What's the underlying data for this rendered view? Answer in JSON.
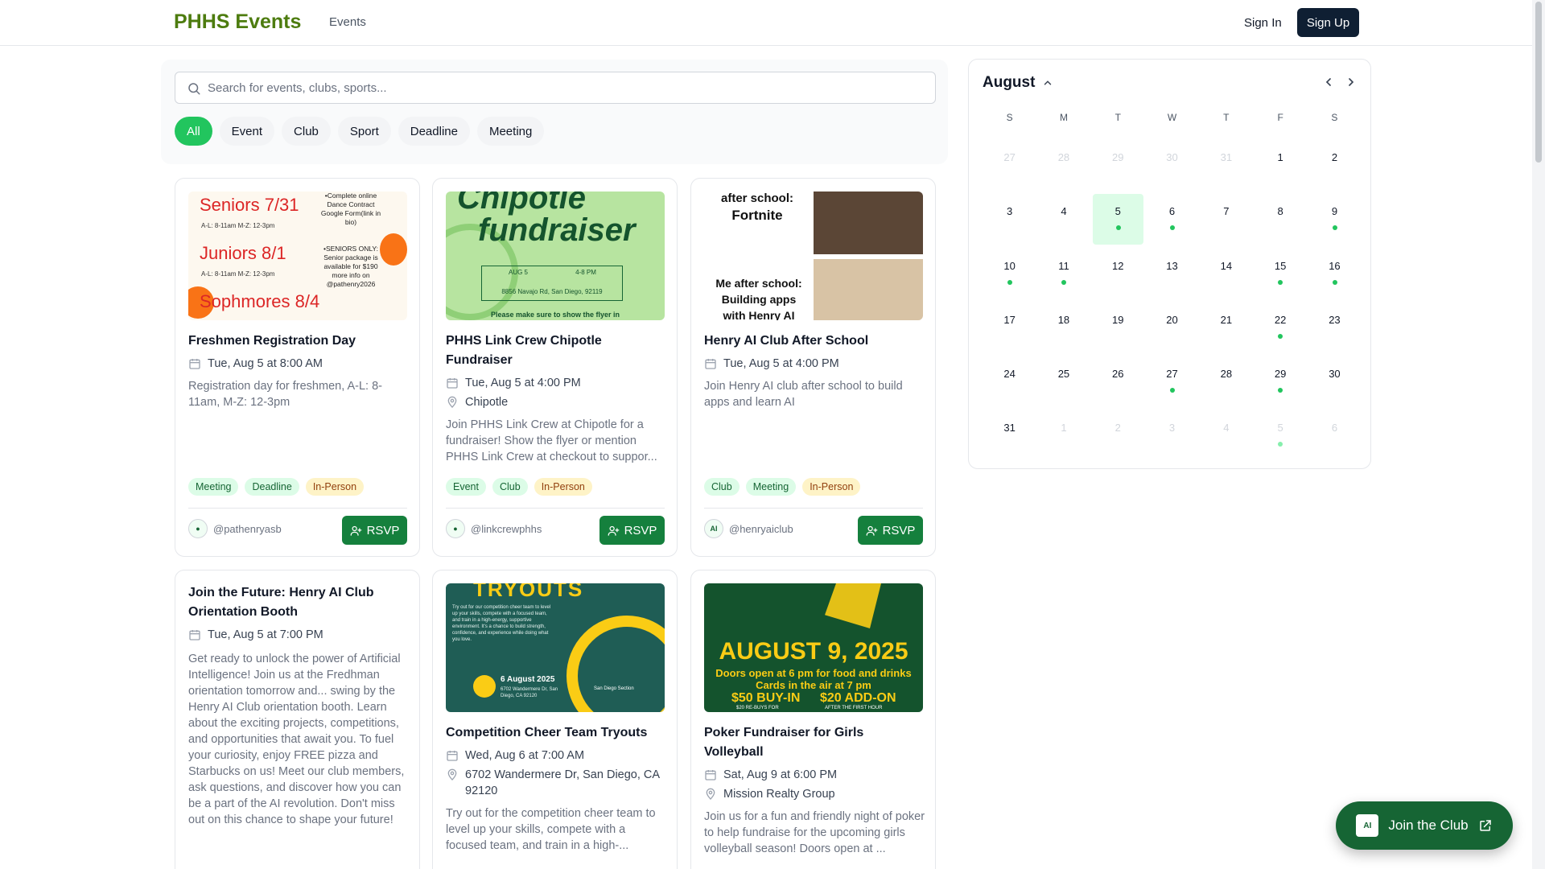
{
  "header": {
    "brand": "PHHS Events",
    "nav_events": "Events",
    "sign_in": "Sign In",
    "sign_up": "Sign Up"
  },
  "search": {
    "placeholder": "Search for events, clubs, sports..."
  },
  "filters": [
    "All",
    "Event",
    "Club",
    "Sport",
    "Deadline",
    "Meeting"
  ],
  "cards": [
    {
      "title": "Freshmen Registration Day",
      "date": "Tue, Aug 5 at 8:00 AM",
      "description": "Registration day for freshmen, A-L: 8-11am, M-Z: 12-3pm",
      "tags": [
        "Meeting",
        "Deadline",
        "In-Person"
      ],
      "author": "@pathenryasb",
      "rsvp": "RSVP",
      "image_text": {
        "l1": "Seniors 7/31",
        "l1s": "A-L: 8-11am   M-Z: 12-3pm",
        "l2": "Juniors 8/1",
        "l2s": "A-L: 8-11am   M-Z: 12-3pm",
        "l3": "Sophmores 8/4",
        "r1": "•Complete online Dance Contract Google Form(link in bio)",
        "r2": "•SENIORS ONLY: Senior package is available for $190 more info on @pathenry2026"
      }
    },
    {
      "title": "PHHS Link Crew Chipotle Fundraiser",
      "date": "Tue, Aug 5 at 4:00 PM",
      "location": "Chipotle",
      "description": "Join PHHS Link Crew at Chipotle for a fundraiser! Show the flyer or mention PHHS Link Crew at checkout to suppor...",
      "tags": [
        "Event",
        "Club",
        "In-Person"
      ],
      "author": "@linkcrewphhs",
      "rsvp": "RSVP",
      "image_text": {
        "t1": "Chipotle",
        "t2": "fundraiser",
        "d1": "AUG 5",
        "d2": "4-8 PM",
        "addr": "8856 Navajo Rd, San Diego, 92119",
        "note": "Please make sure to show the flyer in"
      }
    },
    {
      "title": "Henry AI Club After School",
      "date": "Tue, Aug 5 at 4:00 PM",
      "description": "Join Henry AI club after school to build apps and learn AI",
      "tags": [
        "Club",
        "Meeting",
        "In-Person"
      ],
      "author": "@henryaiclub",
      "rsvp": "RSVP",
      "image_text": {
        "t1": "after school:",
        "t2": "Fortnite",
        "t3": "Me after school:",
        "t4": "Building apps",
        "t5": "with Henry AI"
      }
    },
    {
      "title": "Join the Future: Henry AI Club Orientation Booth",
      "date": "Tue, Aug 5 at 7:00 PM",
      "description": "Get ready to unlock the power of Artificial Intelligence! Join us at the Fredhman orientation tomorrow and... swing by the Henry AI Club orientation booth. Learn about the exciting projects, competitions, and opportunities that await you. To fuel your curiosity, enjoy FREE pizza and Starbucks on us! Meet our club members, ask questions, and discover how you can be a part of the AI revolution. Don't miss out on this chance to shape your future!"
    },
    {
      "title": "Competition Cheer Team Tryouts",
      "date": "Wed, Aug 6 at 7:00 AM",
      "location": "6702 Wandermere Dr, San Diego, CA 92120",
      "description": "Try out for the competition cheer team to level up your skills, compete with a focused team, and train in a high-...",
      "image_text": {
        "t1": "TRYOUTS",
        "body": "Try out for our competition cheer team to level up your skills, compete with a focused team, and train in a high-energy, supportive environment. It's a chance to build strength, confidence, and experience while doing what you love.",
        "date": "6 August 2025",
        "addr": "6702 Wandermere Dr, San Diego, CA 92120",
        "badge": "San Diego Section"
      }
    },
    {
      "title": "Poker Fundraiser for Girls Volleyball",
      "date": "Sat, Aug 9 at 6:00 PM",
      "location": "Mission Realty Group",
      "description": "Join us for a fun and friendly night of poker to help fundraise for the upcoming girls volleyball season! Doors open at ...",
      "image_text": {
        "t1": "AUGUST 9, 2025",
        "t2": "Doors open at 6 pm for food and drinks",
        "t3": "Cards in the air at 7 pm",
        "t4": "$50 BUY-IN",
        "t4s": "$20 RE-BUYS FOR",
        "t5": "$20 ADD-ON",
        "t5s": "AFTER THE FIRST HOUR"
      }
    }
  ],
  "calendar": {
    "month": "August",
    "weekdays": [
      "S",
      "M",
      "T",
      "W",
      "T",
      "F",
      "S"
    ],
    "days": [
      {
        "n": "27",
        "muted": true
      },
      {
        "n": "28",
        "muted": true
      },
      {
        "n": "29",
        "muted": true
      },
      {
        "n": "30",
        "muted": true
      },
      {
        "n": "31",
        "muted": true
      },
      {
        "n": "1"
      },
      {
        "n": "2"
      },
      {
        "n": "3"
      },
      {
        "n": "4"
      },
      {
        "n": "5",
        "today": true,
        "dot": true
      },
      {
        "n": "6",
        "dot": true
      },
      {
        "n": "7"
      },
      {
        "n": "8"
      },
      {
        "n": "9",
        "dot": true
      },
      {
        "n": "10",
        "dot": true
      },
      {
        "n": "11",
        "dot": true
      },
      {
        "n": "12"
      },
      {
        "n": "13"
      },
      {
        "n": "14"
      },
      {
        "n": "15",
        "dot": true
      },
      {
        "n": "16",
        "dot": true
      },
      {
        "n": "17"
      },
      {
        "n": "18"
      },
      {
        "n": "19"
      },
      {
        "n": "20"
      },
      {
        "n": "21"
      },
      {
        "n": "22",
        "dot": true
      },
      {
        "n": "23"
      },
      {
        "n": "24"
      },
      {
        "n": "25"
      },
      {
        "n": "26"
      },
      {
        "n": "27",
        "dot": true
      },
      {
        "n": "28"
      },
      {
        "n": "29",
        "dot": true
      },
      {
        "n": "30"
      },
      {
        "n": "31"
      },
      {
        "n": "1",
        "muted": true
      },
      {
        "n": "2",
        "muted": true
      },
      {
        "n": "3",
        "muted": true
      },
      {
        "n": "4",
        "muted": true
      },
      {
        "n": "5",
        "muted": true,
        "dot": true
      },
      {
        "n": "6",
        "muted": true
      }
    ]
  },
  "join_club": {
    "label": "Join the Club",
    "logo": "AI"
  },
  "colors": {
    "brand": "#4d7c0f",
    "accent_green": "#22c55e",
    "button_green": "#15803d",
    "dark_button": "#0f1f33"
  }
}
